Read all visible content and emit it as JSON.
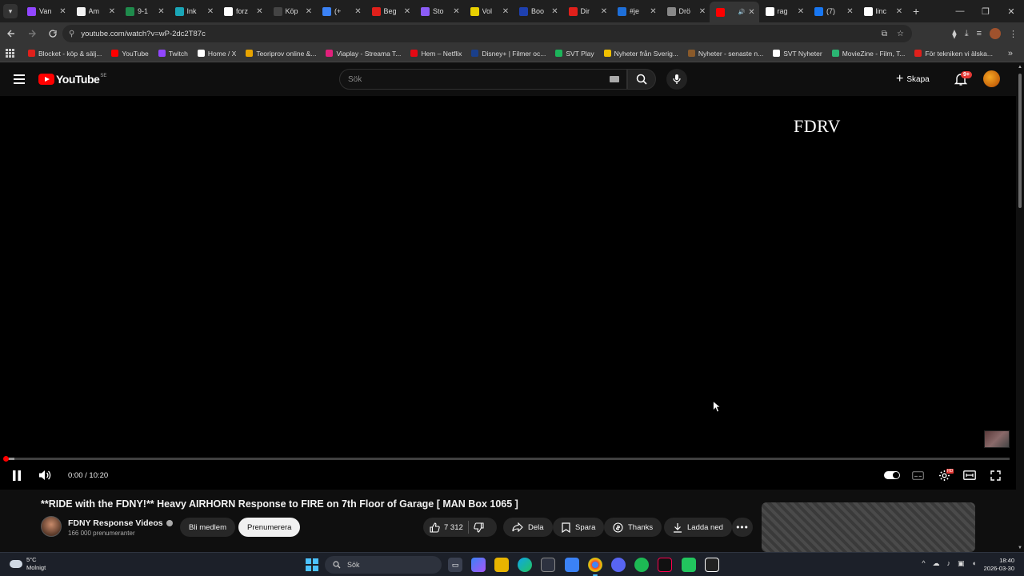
{
  "browser": {
    "tabs": [
      {
        "label": "Van",
        "fav_color": "#9146ff",
        "active": false
      },
      {
        "label": "Am",
        "fav_color": "#f4f4f4",
        "active": false
      },
      {
        "label": "9-1",
        "fav_color": "#1f8b4c",
        "active": false
      },
      {
        "label": "Ink",
        "fav_color": "#1aa6b7",
        "active": false
      },
      {
        "label": "forz",
        "fav_color": "#ffffff",
        "active": false
      },
      {
        "label": "Köp",
        "fav_color": "#444444",
        "active": false
      },
      {
        "label": "(+",
        "fav_color": "#3b82f6",
        "active": false
      },
      {
        "label": "Beg",
        "fav_color": "#e0201b",
        "active": false
      },
      {
        "label": "Sto",
        "fav_color": "#8b5cf6",
        "active": false
      },
      {
        "label": "Vol",
        "fav_color": "#e8d000",
        "active": false
      },
      {
        "label": "Boo",
        "fav_color": "#1e40af",
        "active": false
      },
      {
        "label": "Dir",
        "fav_color": "#e0201b",
        "active": false
      },
      {
        "label": "#je",
        "fav_color": "#1e6fd9",
        "active": false
      },
      {
        "label": "Drö",
        "fav_color": "#888888",
        "active": false
      },
      {
        "label": "",
        "fav_color": "#ff0000",
        "active": true
      },
      {
        "label": "rag",
        "fav_color": "#ffffff",
        "active": false
      },
      {
        "label": "(7)",
        "fav_color": "#1877f2",
        "active": false
      },
      {
        "label": "linc",
        "fav_color": "#ffffff",
        "active": false
      }
    ],
    "url": "youtube.com/watch?v=wP-2dc2T87c",
    "bookmarks": [
      {
        "label": "Blocket - köp & sälj...",
        "color": "#e0201b"
      },
      {
        "label": "YouTube",
        "color": "#ff0000"
      },
      {
        "label": "Twitch",
        "color": "#9146ff"
      },
      {
        "label": "Home / X",
        "color": "#ffffff"
      },
      {
        "label": "Teoriprov online &...",
        "color": "#e8a400"
      },
      {
        "label": "Viaplay - Streama T...",
        "color": "#e0207b"
      },
      {
        "label": "Hem – Netflix",
        "color": "#e50914"
      },
      {
        "label": "Disney+ | Filmer oc...",
        "color": "#1a3f8a"
      },
      {
        "label": "SVT Play",
        "color": "#1cb45a"
      },
      {
        "label": "Nyheter från Sverig...",
        "color": "#f0c000"
      },
      {
        "label": "Nyheter - senaste n...",
        "color": "#8a5a2a"
      },
      {
        "label": "SVT Nyheter",
        "color": "#ffffff"
      },
      {
        "label": "MovieZine - Film, T...",
        "color": "#2bb673"
      },
      {
        "label": "För tekniken vi älska...",
        "color": "#e0201b"
      }
    ]
  },
  "youtube": {
    "logo_text": "YouTube",
    "country_code": "SE",
    "search_placeholder": "Sök",
    "create_label": "Skapa",
    "notification_badge": "9+",
    "player": {
      "watermark": "FDRV",
      "time_display": "0:00 / 10:20",
      "progress_played": 0.0,
      "progress_buffered": 0.008
    },
    "video": {
      "title": "**RIDE with the FDNY!** Heavy AIRHORN Response to FIRE on 7th Floor of Garage [ MAN Box 1065 ]",
      "channel_name": "FDNY Response Videos",
      "subscribers": "166 000 prenumeranter",
      "join_label": "Bli medlem",
      "subscribe_label": "Prenumerera",
      "likes": "7 312",
      "share_label": "Dela",
      "save_label": "Spara",
      "thanks_label": "Thanks",
      "download_label": "Ladda ned"
    }
  },
  "taskbar": {
    "weather_temp": "5°C",
    "weather_desc": "Molnigt",
    "search_label": "Sök",
    "time": "18:40",
    "date": "2026-03-30"
  }
}
